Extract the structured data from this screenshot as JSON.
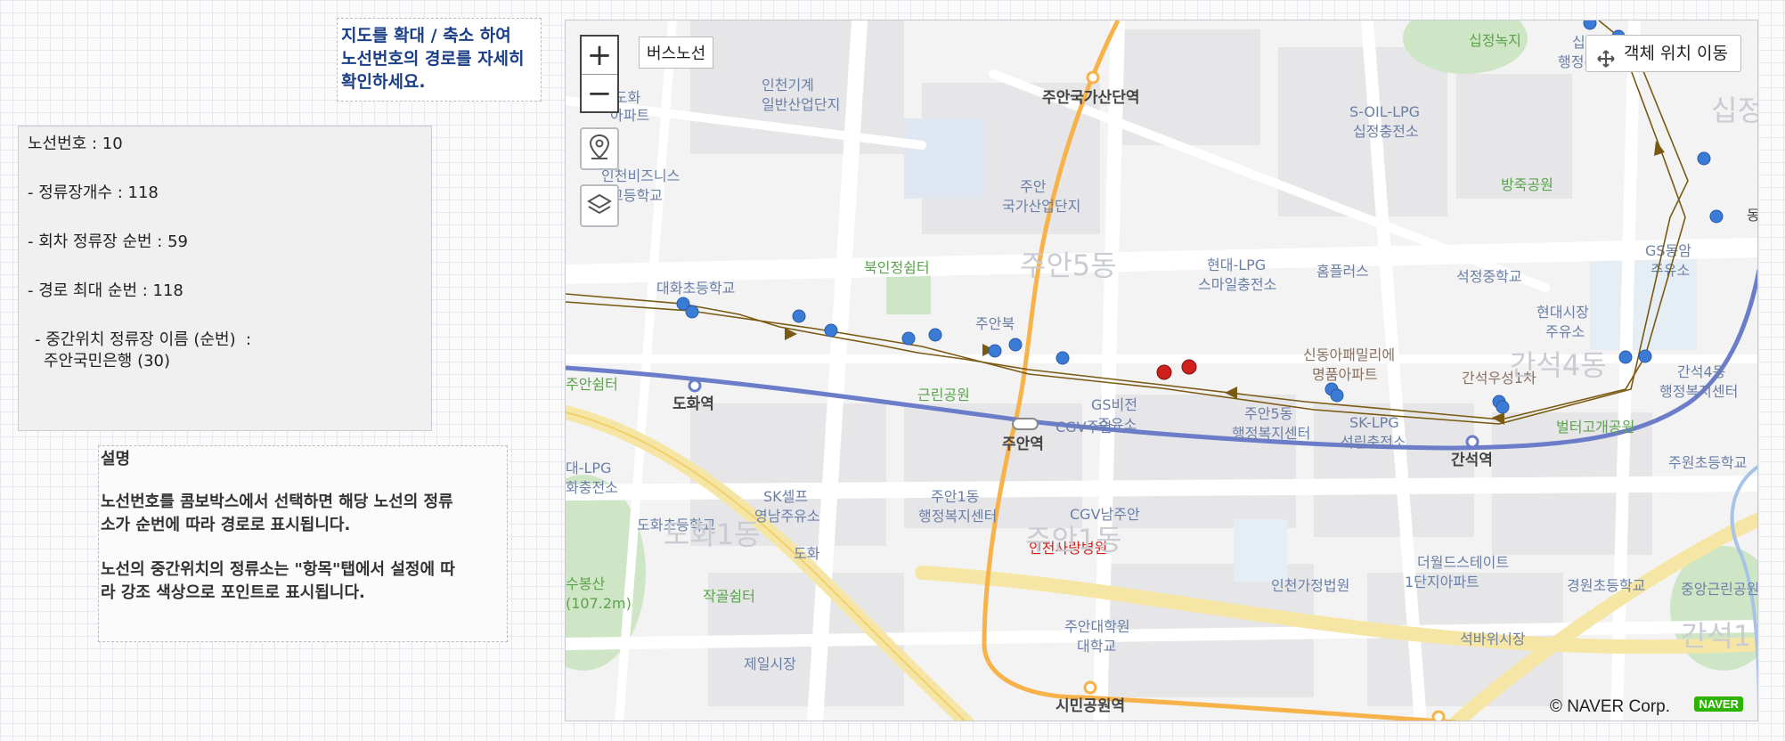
{
  "tip": {
    "line1": "지도를  확대 / 축소 하여",
    "line2": "노선번호의 경로를 자세히",
    "line3": "확인하세요."
  },
  "info": {
    "route_no": "노선번호 : 10",
    "stop_count": "- 정류장개수 : 118",
    "turn_seq": "- 회차 정류장 순번 : 59",
    "max_seq": "- 경로 최대 순번 : 118",
    "mid_stop_label": "- 중간위치 정류장 이름 (순번)  :",
    "mid_stop_value": "주안국민은행 (30)"
  },
  "desc": {
    "heading": "설명",
    "para1_line1": "노선번호를 콤보박스에서 선택하면 해당 노선의 정류",
    "para1_line2": "소가 순번에 따라 경로로 표시됩니다.",
    "para2_line1": "노선의 중간위치의 정류소는 \"항목\"탭에서 설정에 따",
    "para2_line2": "라 강조 색상으로 포인트로 표시됩니다."
  },
  "map": {
    "route_label": "버스노선",
    "move_all_label": "객체 위치 이동",
    "zoom_in": "+",
    "zoom_out": "−",
    "copyright": "© NAVER Corp.",
    "logo_text": "NAVER",
    "route_color": "#7a5a12",
    "stop_color": "#3a7bd5",
    "mid_stop_color": "#d0201c",
    "icons": [
      "location-pin-icon",
      "layers-icon",
      "move-arrows-icon"
    ],
    "places": {
      "p1": "인천기계",
      "p1b": "일반산업단지",
      "p2": "주안국가산단역",
      "p3": "S-OIL-LPG",
      "p3b": "십정충전소",
      "p4": "방죽공원",
      "p5": "주안",
      "p5b": "국가산업단지",
      "p6": "북인정쉼터",
      "p7": "주안5동",
      "p8": "현대-LPG",
      "p8b": "스마일충전소",
      "p9": "홈플러스",
      "p10": "석정중학교",
      "p11": "대화초등학교",
      "p12": "주안북",
      "p13": "근린공원",
      "p14": "신동아패밀리에",
      "p14b": "명품아파트",
      "p15": "간석우성1차",
      "p16": "현대시장",
      "p16b": "주유소",
      "p17": "GS동암",
      "p17b": "주유소",
      "p18": "간석4동",
      "p18b": "행정복지센터",
      "p19": "도화역",
      "p20": "GS비전",
      "p20b": "주유소",
      "p21": "주안역",
      "p22": "CGV주안",
      "p23": "주안5동",
      "p23b": "행정복지센터",
      "p24": "SK-LPG",
      "p24b": "석림충전소",
      "p25": "간석역",
      "p26": "벌터고개공원",
      "p27": "주원초등학교",
      "p28": "SK셀프",
      "p28b": "영남주유소",
      "p29": "주안1동",
      "p29b": "행정복지센터",
      "p30": "CGV남주안",
      "p31": "주안1동",
      "p32": "인천사랑병원",
      "p33": "도화1동",
      "p34": "도화초등학교",
      "p35": "도화",
      "p36": "인천가정법원",
      "p37": "더월드스테이트",
      "p37b": "1단지아파트",
      "p38": "경원초등학교",
      "p39": "중앙근린공원",
      "p40": "작골쉼터",
      "p41": "주안대학원",
      "p41b": "대학교",
      "p42": "제일시장",
      "p43": "석바위시장",
      "p44": "시민공원역",
      "p45": "간석1",
      "p46": "수봉산",
      "p46b": "(107.2m)",
      "p47": "십정녹지",
      "p48": "십정1동",
      "p48b": "행정복지센터",
      "p49": "인천비즈니스",
      "p49b": "고등학교",
      "p50": "상도화",
      "p50b": "아파트",
      "p51": "대-LPG",
      "p51b": "화충전소",
      "p52": "주안쉼터",
      "p53": "간석4동",
      "p54": "십정",
      "p55": "동"
    }
  }
}
